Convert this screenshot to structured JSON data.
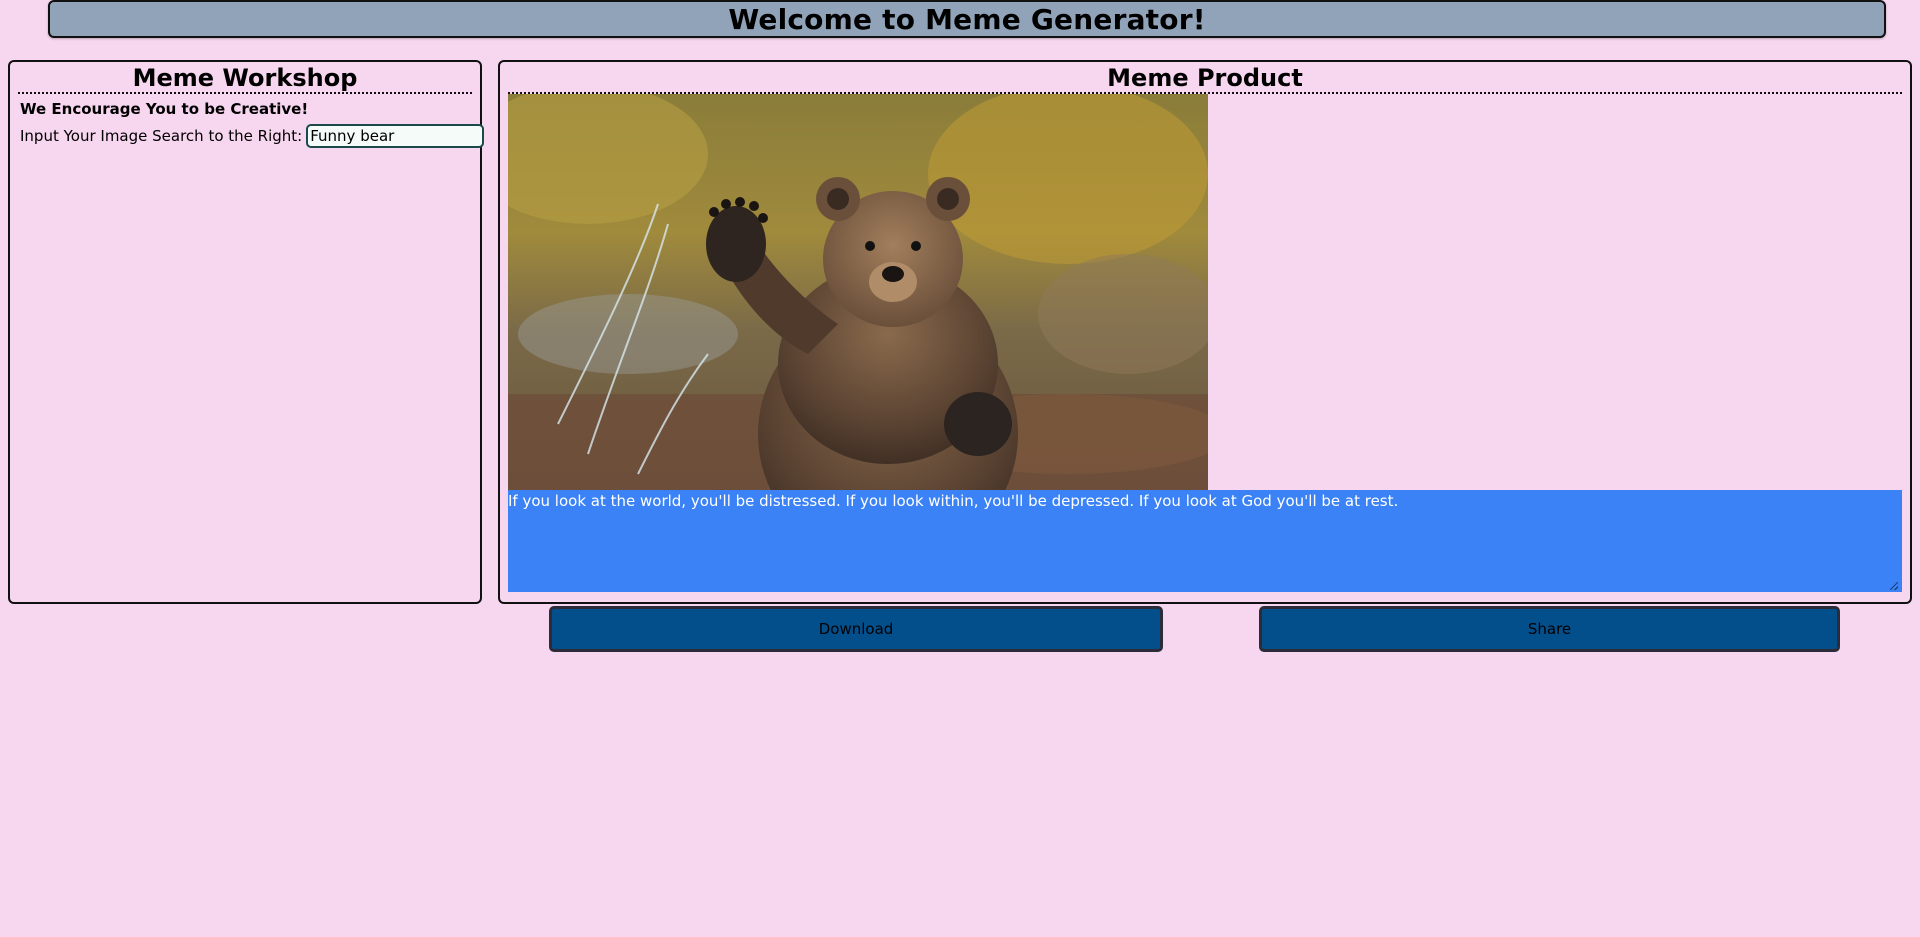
{
  "header": {
    "title": "Welcome to Meme Generator!"
  },
  "workshop": {
    "title": "Meme Workshop",
    "subtitle": "We Encourage You to be Creative!",
    "search_label": "Input Your Image Search to the Right:",
    "search_value": "Funny bear"
  },
  "product": {
    "title": "Meme Product",
    "image_subject": "brown bear waving",
    "caption": "If you look at the world, you'll be distressed. If you look within, you'll be depressed. If you look at God you'll be at rest."
  },
  "actions": {
    "download_label": "Download",
    "share_label": "Share"
  },
  "colors": {
    "page_background": "#f7d6ef",
    "header_background": "#91a3b8",
    "caption_background": "#3b82f6",
    "button_background": "#034f8c"
  }
}
